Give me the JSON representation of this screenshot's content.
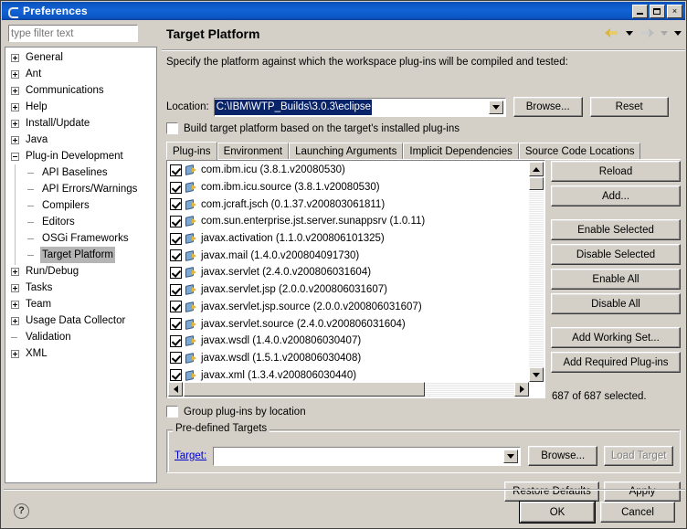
{
  "window": {
    "title": "Preferences",
    "minimize": "Minimize",
    "maximize": "Maximize",
    "close": "×"
  },
  "sidebar": {
    "filter_placeholder": "type filter text",
    "filter_value": "",
    "items": [
      {
        "label": "General",
        "expandable": true,
        "expanded": false,
        "child": false
      },
      {
        "label": "Ant",
        "expandable": true,
        "expanded": false,
        "child": false
      },
      {
        "label": "Communications",
        "expandable": true,
        "expanded": false,
        "child": false
      },
      {
        "label": "Help",
        "expandable": true,
        "expanded": false,
        "child": false
      },
      {
        "label": "Install/Update",
        "expandable": true,
        "expanded": false,
        "child": false
      },
      {
        "label": "Java",
        "expandable": true,
        "expanded": false,
        "child": false
      },
      {
        "label": "Plug-in Development",
        "expandable": true,
        "expanded": true,
        "child": false
      },
      {
        "label": "API Baselines",
        "expandable": false,
        "expanded": false,
        "child": true
      },
      {
        "label": "API Errors/Warnings",
        "expandable": false,
        "expanded": false,
        "child": true
      },
      {
        "label": "Compilers",
        "expandable": false,
        "expanded": false,
        "child": true
      },
      {
        "label": "Editors",
        "expandable": false,
        "expanded": false,
        "child": true
      },
      {
        "label": "OSGi Frameworks",
        "expandable": false,
        "expanded": false,
        "child": true
      },
      {
        "label": "Target Platform",
        "expandable": false,
        "expanded": false,
        "child": true,
        "selected": true
      },
      {
        "label": "Run/Debug",
        "expandable": true,
        "expanded": false,
        "child": false
      },
      {
        "label": "Tasks",
        "expandable": true,
        "expanded": false,
        "child": false
      },
      {
        "label": "Team",
        "expandable": true,
        "expanded": false,
        "child": false
      },
      {
        "label": "Usage Data Collector",
        "expandable": true,
        "expanded": false,
        "child": false
      },
      {
        "label": "Validation",
        "expandable": false,
        "expanded": false,
        "child": false,
        "leafRoot": true
      },
      {
        "label": "XML",
        "expandable": true,
        "expanded": false,
        "child": false
      }
    ]
  },
  "page": {
    "title": "Target Platform",
    "description": "Specify the platform against which the workspace plug-ins will be compiled and tested:",
    "location_label": "Location:",
    "location_value": "C:\\IBM\\WTP_Builds\\3.0.3\\eclipse",
    "browse_label": "Browse...",
    "reset_label": "Reset",
    "build_checkbox_label": "Build target platform based on the target's installed plug-ins",
    "build_checkbox_checked": false,
    "group_checkbox_label": "Group plug-ins by location",
    "group_checkbox_checked": false
  },
  "tabs": [
    {
      "label": "Plug-ins",
      "active": true
    },
    {
      "label": "Environment",
      "active": false
    },
    {
      "label": "Launching Arguments",
      "active": false
    },
    {
      "label": "Implicit Dependencies",
      "active": false
    },
    {
      "label": "Source Code Locations",
      "active": false
    }
  ],
  "plugins": {
    "rows": [
      {
        "name": "com.ibm.icu (3.8.1.v20080530)",
        "checked": true
      },
      {
        "name": "com.ibm.icu.source (3.8.1.v20080530)",
        "checked": true
      },
      {
        "name": "com.jcraft.jsch (0.1.37.v200803061811)",
        "checked": true
      },
      {
        "name": "com.sun.enterprise.jst.server.sunappsrv (1.0.11)",
        "checked": true
      },
      {
        "name": "javax.activation (1.1.0.v200806101325)",
        "checked": true
      },
      {
        "name": "javax.mail (1.4.0.v200804091730)",
        "checked": true
      },
      {
        "name": "javax.servlet (2.4.0.v200806031604)",
        "checked": true
      },
      {
        "name": "javax.servlet.jsp (2.0.0.v200806031607)",
        "checked": true
      },
      {
        "name": "javax.servlet.jsp.source (2.0.0.v200806031607)",
        "checked": true
      },
      {
        "name": "javax.servlet.source (2.4.0.v200806031604)",
        "checked": true
      },
      {
        "name": "javax.wsdl (1.4.0.v200806030407)",
        "checked": true
      },
      {
        "name": "javax.wsdl (1.5.1.v200806030408)",
        "checked": true
      },
      {
        "name": "javax.xml (1.3.4.v200806030440)",
        "checked": true
      }
    ],
    "count_label": "687 of 687 selected."
  },
  "side_buttons": [
    {
      "label": "Reload",
      "disabled": false,
      "gap": false
    },
    {
      "label": "Add...",
      "disabled": false,
      "gap": true
    },
    {
      "label": "Enable Selected",
      "disabled": false,
      "gap": false
    },
    {
      "label": "Disable Selected",
      "disabled": false,
      "gap": false
    },
    {
      "label": "Enable All",
      "disabled": false,
      "gap": false
    },
    {
      "label": "Disable All",
      "disabled": false,
      "gap": true
    },
    {
      "label": "Add Working Set...",
      "disabled": false,
      "gap": false
    },
    {
      "label": "Add Required Plug-ins",
      "disabled": false,
      "gap": false
    }
  ],
  "predefined": {
    "group_title": "Pre-defined Targets",
    "target_label": "Target:",
    "target_value": "",
    "browse_label": "Browse...",
    "load_label": "Load Target",
    "load_disabled": true
  },
  "page_actions": {
    "restore_defaults": "Restore Defaults",
    "apply": "Apply"
  },
  "footer": {
    "help": "?",
    "ok": "OK",
    "cancel": "Cancel"
  }
}
